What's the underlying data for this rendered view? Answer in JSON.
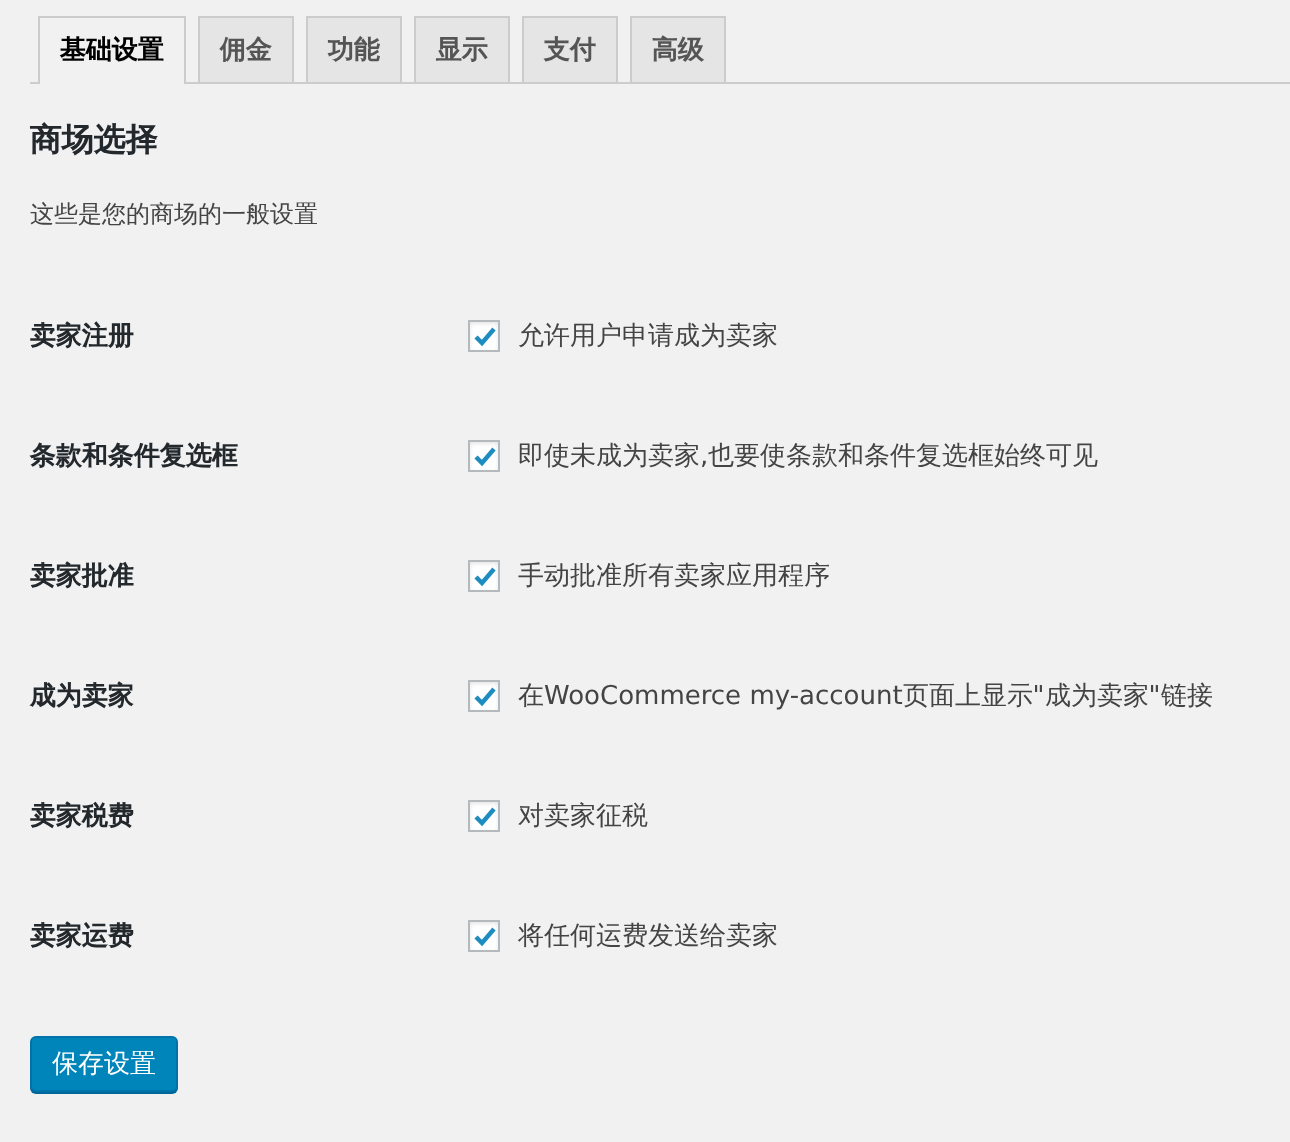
{
  "tabs": [
    {
      "label": "基础设置",
      "selected": true
    },
    {
      "label": "佣金",
      "selected": false
    },
    {
      "label": "功能",
      "selected": false
    },
    {
      "label": "显示",
      "selected": false
    },
    {
      "label": "支付",
      "selected": false
    },
    {
      "label": "高级",
      "selected": false
    }
  ],
  "section": {
    "title": "商场选择",
    "description": "这些是您的商场的一般设置"
  },
  "settings": [
    {
      "label": "卖家注册",
      "option": "允许用户申请成为卖家",
      "checked": true
    },
    {
      "label": "条款和条件复选框",
      "option": "即使未成为卖家,也要使条款和条件复选框始终可见",
      "checked": true
    },
    {
      "label": "卖家批准",
      "option": "手动批准所有卖家应用程序",
      "checked": true
    },
    {
      "label": "成为卖家",
      "option": "在WooCommerce my-account页面上显示\"成为卖家\"链接",
      "checked": true
    },
    {
      "label": "卖家税费",
      "option": "对卖家征税",
      "checked": true
    },
    {
      "label": "卖家运费",
      "option": "将任何运费发送给卖家",
      "checked": true
    }
  ],
  "save_button": "保存设置"
}
